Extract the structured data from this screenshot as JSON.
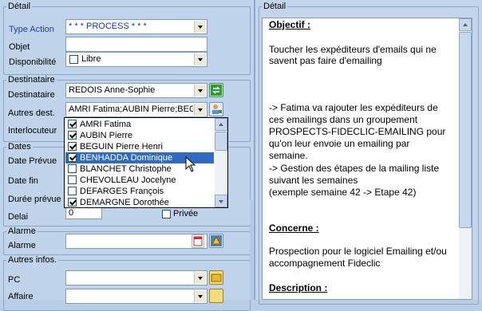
{
  "colors": {
    "label_blue": "#1f3fb6",
    "selection": "#316ac5",
    "panel_bg": "#bfd3ea"
  },
  "detail_group": {
    "legend": "Détail",
    "type_action_label": "Type Action",
    "type_action_value": "* * * PROCESS * * *",
    "objet_label": "Objet",
    "objet_value": "",
    "disponibilite_label": "Disponibilité",
    "disponibilite_value": "Libre"
  },
  "destinataire_group": {
    "legend": "Destinataire",
    "destinataire_label": "Destinataire",
    "destinataire_value": "REDOIS Anne-Sophie",
    "autres_dest_label": "Autres dest.",
    "autres_dest_value": "AMRI Fatima;AUBIN Pierre;BEGUI",
    "interlocuteur_label": "Interlocuteur"
  },
  "dates_group": {
    "legend": "Dates",
    "date_prevue_label": "Date Prévue",
    "date_fin_label": "Date fin",
    "duree_prevue_label": "Durée prévue",
    "delai_label": "Delai",
    "delai_value": "0",
    "privee_label": "Privée"
  },
  "alarme_group": {
    "legend": "Alarme",
    "alarme_label": "Alarme"
  },
  "autres_infos_group": {
    "legend": "Autres infos.",
    "pc_label": "PC",
    "affaire_label": "Affaire"
  },
  "recipients_list": [
    {
      "name": "AMRI Fatima",
      "checked": true
    },
    {
      "name": "AUBIN Pierre",
      "checked": true
    },
    {
      "name": "BEGUIN Pierre Henri",
      "checked": true
    },
    {
      "name": "BENHADDA Dominique",
      "checked": true
    },
    {
      "name": "BLANCHET Christophe",
      "checked": false
    },
    {
      "name": "CHEVOLLEAU  Jocelyne",
      "checked": false
    },
    {
      "name": "DEFARGES François",
      "checked": false
    },
    {
      "name": "DEMARGNE Dorothée",
      "checked": true
    }
  ],
  "right_panel": {
    "legend": "Détail",
    "objectif_heading": "Objectif :",
    "objectif_lines": [
      "Toucher les expéditeurs d'emails qui ne",
      "savent pas faire d'emailing"
    ],
    "action_lines": [
      "-> Fatima va rajouter les expéditeurs de",
      "ces emailings dans un groupement",
      "PROSPECTS-FIDECLIC-EMAILING pour",
      "qu'on leur envoie un emailing par",
      "semaine.",
      "-> Gestion des étapes de la mailing liste",
      "suivant les semaines",
      "(exemple semaine 42 -> Etape 42)"
    ],
    "concerne_heading": "Concerne :",
    "concerne_lines": [
      "Prospection pour le logiciel Emailing et/ou",
      "accompagnement Fideclic"
    ],
    "description_heading": "Description :"
  }
}
